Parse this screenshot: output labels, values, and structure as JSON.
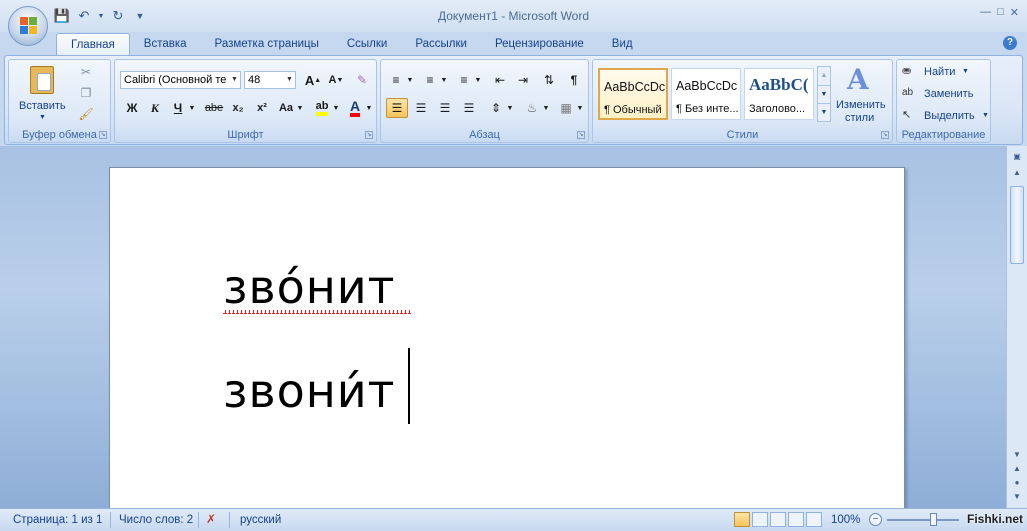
{
  "window": {
    "title": "Документ1 - Microsoft Word"
  },
  "tabs": [
    "Главная",
    "Вставка",
    "Разметка страницы",
    "Ссылки",
    "Рассылки",
    "Рецензирование",
    "Вид"
  ],
  "clipboard": {
    "paste_label": "Вставить",
    "group_label": "Буфер обмена"
  },
  "font": {
    "name": "Calibri (Основной те",
    "size": "48",
    "group_label": "Шрифт",
    "bold": "Ж",
    "italic": "К",
    "underline": "Ч",
    "strike": "abe",
    "subscript": "x₂",
    "superscript": "x²",
    "case": "Aa",
    "grow": "A",
    "shrink": "A"
  },
  "paragraph": {
    "group_label": "Абзац",
    "pilcrow": "¶"
  },
  "styles": {
    "group_label": "Стили",
    "change_label_1": "Изменить",
    "change_label_2": "стили",
    "items": [
      {
        "sample": "AaBbCcDc",
        "name": "¶ Обычный"
      },
      {
        "sample": "AaBbCcDc",
        "name": "¶ Без инте..."
      },
      {
        "sample": "AaBbC(",
        "name": "Заголово..."
      }
    ]
  },
  "editing": {
    "group_label": "Редактирование",
    "find": "Найти",
    "replace": "Заменить",
    "select": "Выделить"
  },
  "document": {
    "line1": "звóнит",
    "line2": "звони́т"
  },
  "status": {
    "page": "Страница: 1 из 1",
    "words": "Число слов: 2",
    "language": "русский",
    "zoom": "100%",
    "watermark": "Fishki.net"
  },
  "colors": {
    "accent": "#15428b",
    "highlight": "#ffff00",
    "font_color": "#ff0000"
  }
}
